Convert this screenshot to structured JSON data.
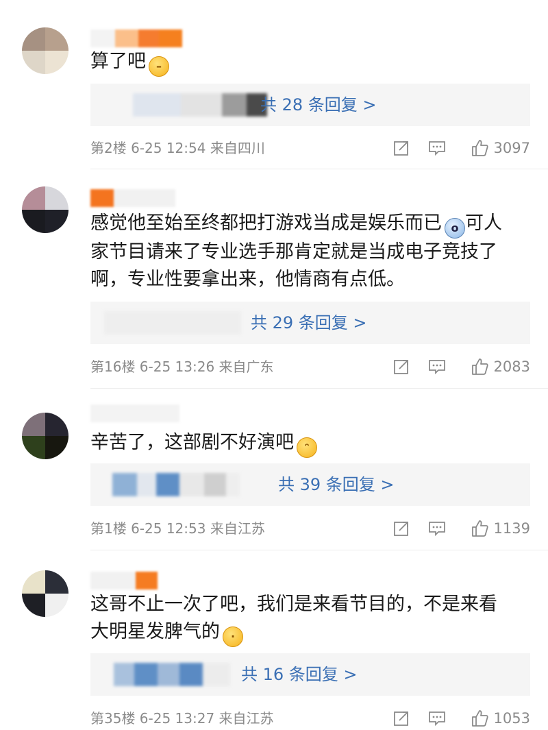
{
  "comments": [
    {
      "text": "算了吧",
      "emoji_icon": "smirk-emoji-icon",
      "reply_link": "共 28 条回复 >",
      "meta": "第2楼 6-25 12:54 来自四川",
      "likes": "3097"
    },
    {
      "text_line1": "感觉他至始至终都把打游戏当成是娱乐而已",
      "text_line1b": "可人",
      "text_line2": "家节目请来了专业选手那肯定就是当成电子竞技了",
      "text_line3": "啊，专业性要拿出来，他情商有点低。",
      "emoji_icon": "shocked-panda-emoji-icon",
      "reply_link": "共 29 条回复 >",
      "meta": "第16楼 6-25 13:26 来自广东",
      "likes": "2083"
    },
    {
      "text": "辛苦了，这部剧不好演吧",
      "emoji_icon": "laugh-cry-emoji-icon",
      "reply_link": "共 39 条回复 >",
      "meta": "第1楼 6-25 12:53 来自江苏",
      "likes": "1139"
    },
    {
      "text_line1": "这哥不止一次了吧，我们是来看节目的，不是来看",
      "text_line2": "大明星发脾气的",
      "emoji_icon": "thinking-emoji-icon",
      "reply_link": "共 16 条回复 >",
      "meta": "第35楼 6-25 13:27 来自江苏",
      "likes": "1053"
    }
  ],
  "colors": {
    "link": "#3a6fb4",
    "meta": "#8a8a8a",
    "reply_bg": "#f5f5f5"
  }
}
